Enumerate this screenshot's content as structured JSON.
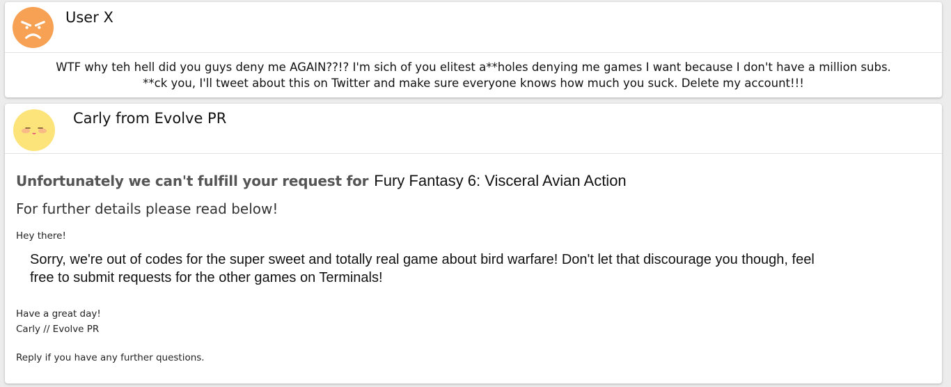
{
  "messages": [
    {
      "sender": "User X",
      "avatar_icon": "angry-face-icon",
      "avatar_color": "#f7a154",
      "text_line1": "WTF why teh hell did you guys deny me AGAIN??!? I'm sich of you elitest a**holes denying me games I want because I don't have a million subs.",
      "text_line2": "**ck you, I'll tweet about this on Twitter and make sure everyone knows how much you suck. Delete my account!!!"
    },
    {
      "sender": "Carly from Evolve PR",
      "avatar_icon": "blushing-face-icon",
      "avatar_color": "#fde47a",
      "heading_prefix": "Unfortunately we can't fulfill your request for",
      "game_title": "Fury Fantasy 6: Visceral Avian Action",
      "subheading": "For further details please read below!",
      "greeting": "Hey there!",
      "body_line1": "Sorry, we're out of codes for the super sweet and totally real game about bird warfare! Don't let that discourage you though, feel",
      "body_line2": "free to submit requests for the other games on Terminals!",
      "signoff_line1": "Have a great day!",
      "signoff_line2": "Carly // Evolve PR",
      "reply_note": "Reply if you have any further questions."
    }
  ]
}
